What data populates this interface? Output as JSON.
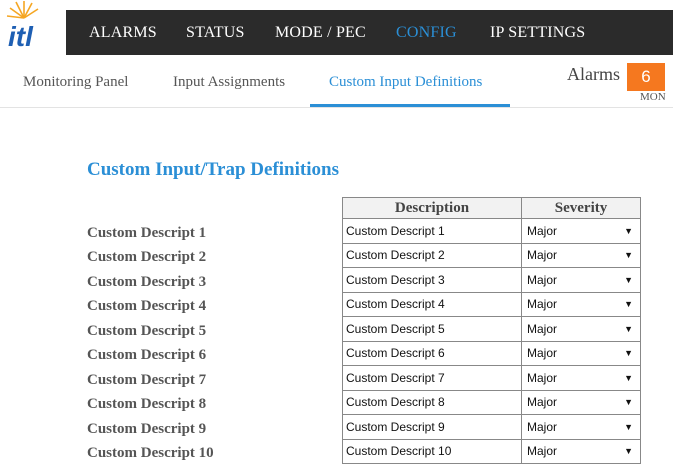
{
  "nav": {
    "logo_text": "itl",
    "items": [
      {
        "label": "ALARMS"
      },
      {
        "label": "STATUS"
      },
      {
        "label": "MODE / PEC"
      },
      {
        "label": "CONFIG"
      },
      {
        "label": "IP SETTINGS"
      }
    ],
    "active": "CONFIG"
  },
  "subnav": {
    "items": [
      {
        "label": "Monitoring Panel"
      },
      {
        "label": "Input Assignments"
      },
      {
        "label": "Custom Input Definitions"
      }
    ],
    "active": "Custom Input Definitions"
  },
  "alarms": {
    "label": "Alarms",
    "count": "6",
    "sublabel": "MON",
    "color": "#f5781f"
  },
  "page": {
    "title": "Custom Input/Trap Definitions"
  },
  "table": {
    "headers": {
      "description": "Description",
      "severity": "Severity"
    },
    "rows": [
      {
        "label": "Custom Descript 1",
        "description": "Custom Descript 1",
        "severity": "Major"
      },
      {
        "label": "Custom Descript 2",
        "description": "Custom Descript 2",
        "severity": "Major"
      },
      {
        "label": "Custom Descript 3",
        "description": "Custom Descript 3",
        "severity": "Major"
      },
      {
        "label": "Custom Descript 4",
        "description": "Custom Descript 4",
        "severity": "Major"
      },
      {
        "label": "Custom Descript 5",
        "description": "Custom Descript 5",
        "severity": "Major"
      },
      {
        "label": "Custom Descript 6",
        "description": "Custom Descript 6",
        "severity": "Major"
      },
      {
        "label": "Custom Descript 7",
        "description": "Custom Descript 7",
        "severity": "Major"
      },
      {
        "label": "Custom Descript 8",
        "description": "Custom Descript 8",
        "severity": "Major"
      },
      {
        "label": "Custom Descript 9",
        "description": "Custom Descript 9",
        "severity": "Major"
      },
      {
        "label": "Custom Descript 10",
        "description": "Custom Descript 10",
        "severity": "Major"
      }
    ]
  },
  "colors": {
    "accent": "#2b8fd6",
    "nav_bg": "#2b2b2b",
    "alarm": "#f5781f"
  }
}
